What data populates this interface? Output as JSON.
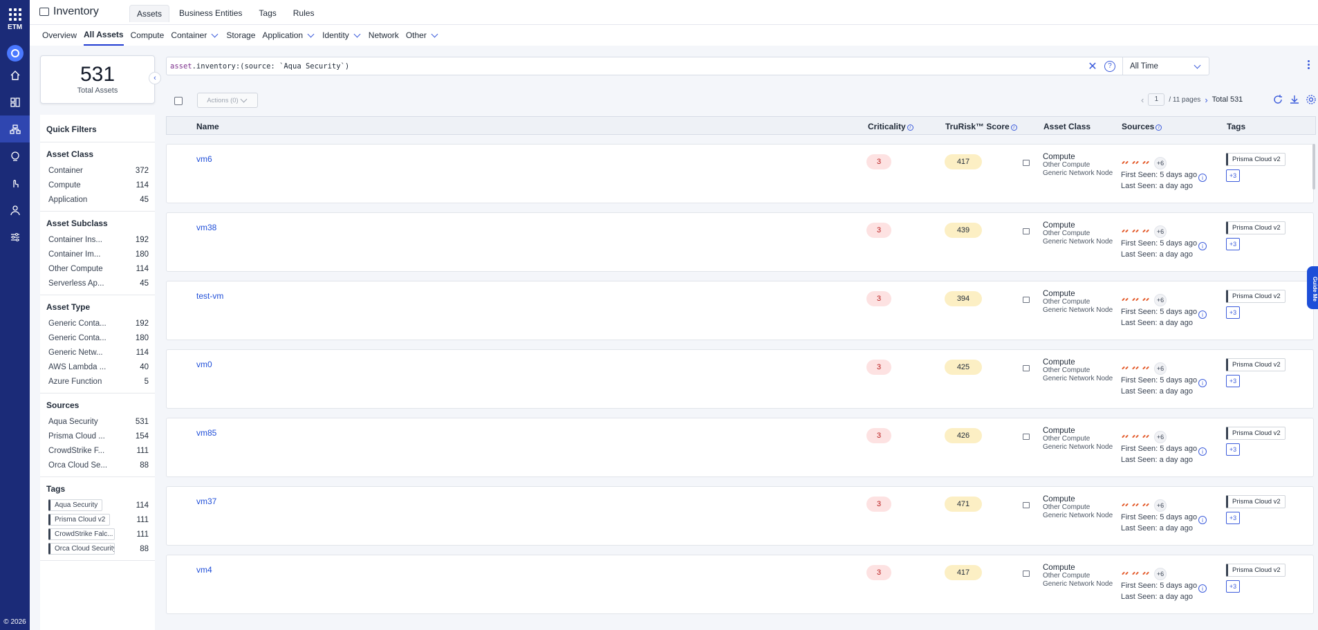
{
  "rail": {
    "product": "ETM",
    "copyright": "© 2026",
    "icons": [
      "apps-grid-icon",
      "qualys-logo-icon",
      "home-icon",
      "dashboard-icon",
      "inventory-icon",
      "risk-icon",
      "touch-icon",
      "user-icon",
      "settings-sliders-icon"
    ]
  },
  "header": {
    "title": "Inventory",
    "tabs": [
      {
        "label": "Assets",
        "active": true
      },
      {
        "label": "Business Entities",
        "active": false
      },
      {
        "label": "Tags",
        "active": false
      },
      {
        "label": "Rules",
        "active": false
      }
    ]
  },
  "subnav": [
    {
      "label": "Overview",
      "active": false,
      "dropdown": false
    },
    {
      "label": "All Assets",
      "active": true,
      "dropdown": false
    },
    {
      "label": "Compute",
      "active": false,
      "dropdown": false
    },
    {
      "label": "Container",
      "active": false,
      "dropdown": true
    },
    {
      "label": "Storage",
      "active": false,
      "dropdown": false
    },
    {
      "label": "Application",
      "active": false,
      "dropdown": true
    },
    {
      "label": "Identity",
      "active": false,
      "dropdown": true
    },
    {
      "label": "Network",
      "active": false,
      "dropdown": false
    },
    {
      "label": "Other",
      "active": false,
      "dropdown": true
    }
  ],
  "summary": {
    "total": "531",
    "label": "Total Assets"
  },
  "quick_filters": {
    "title": "Quick Filters",
    "groups": [
      {
        "title": "Asset Class",
        "items": [
          {
            "label": "Container",
            "count": "372"
          },
          {
            "label": "Compute",
            "count": "114"
          },
          {
            "label": "Application",
            "count": "45"
          }
        ]
      },
      {
        "title": "Asset Subclass",
        "items": [
          {
            "label": "Container Ins...",
            "count": "192"
          },
          {
            "label": "Container Im...",
            "count": "180"
          },
          {
            "label": "Other Compute",
            "count": "114"
          },
          {
            "label": "Serverless Ap...",
            "count": "45"
          }
        ]
      },
      {
        "title": "Asset Type",
        "items": [
          {
            "label": "Generic Conta...",
            "count": "192"
          },
          {
            "label": "Generic Conta...",
            "count": "180"
          },
          {
            "label": "Generic Netw...",
            "count": "114"
          },
          {
            "label": "AWS Lambda ...",
            "count": "40"
          },
          {
            "label": "Azure Function",
            "count": "5"
          }
        ]
      },
      {
        "title": "Sources",
        "items": [
          {
            "label": "Aqua Security",
            "count": "531"
          },
          {
            "label": "Prisma Cloud ...",
            "count": "154"
          },
          {
            "label": "CrowdStrike F...",
            "count": "111"
          },
          {
            "label": "Orca Cloud Se...",
            "count": "88"
          }
        ]
      }
    ],
    "tags": {
      "title": "Tags",
      "items": [
        {
          "label": "Aqua Security",
          "count": "114"
        },
        {
          "label": "Prisma Cloud v2",
          "count": "111"
        },
        {
          "label": "CrowdStrike Falc...",
          "count": "111"
        },
        {
          "label": "Orca Cloud Security",
          "count": "88"
        }
      ]
    }
  },
  "search": {
    "query_prefix": "asset",
    "query_rest": ".inventory:(source: `Aqua Security`)",
    "time_filter": "All Time"
  },
  "toolbar": {
    "actions_label": "Actions (0)",
    "page": "1",
    "pages_label": "/ 11 pages",
    "total_label": "Total 531"
  },
  "columns": {
    "name": "Name",
    "criticality": "Criticality",
    "score": "TruRisk™ Score",
    "asset_class": "Asset Class",
    "sources": "Sources",
    "tags": "Tags"
  },
  "rows": [
    {
      "name": "vm6",
      "criticality": "3",
      "score": "417",
      "cls": "Compute",
      "subclass": "Other Compute",
      "type": "Generic Network Node",
      "more_sources": "+6",
      "first_seen": "First Seen: 5 days ago",
      "last_seen": "Last Seen: a day ago",
      "tag": "Prisma Cloud v2",
      "more_tags": "+3"
    },
    {
      "name": "vm38",
      "criticality": "3",
      "score": "439",
      "cls": "Compute",
      "subclass": "Other Compute",
      "type": "Generic Network Node",
      "more_sources": "+6",
      "first_seen": "First Seen: 5 days ago",
      "last_seen": "Last Seen: a day ago",
      "tag": "Prisma Cloud v2",
      "more_tags": "+3"
    },
    {
      "name": "test-vm",
      "criticality": "3",
      "score": "394",
      "cls": "Compute",
      "subclass": "Other Compute",
      "type": "Generic Network Node",
      "more_sources": "+6",
      "first_seen": "First Seen: 5 days ago",
      "last_seen": "Last Seen: a day ago",
      "tag": "Prisma Cloud v2",
      "more_tags": "+3"
    },
    {
      "name": "vm0",
      "criticality": "3",
      "score": "425",
      "cls": "Compute",
      "subclass": "Other Compute",
      "type": "Generic Network Node",
      "more_sources": "+6",
      "first_seen": "First Seen: 5 days ago",
      "last_seen": "Last Seen: a day ago",
      "tag": "Prisma Cloud v2",
      "more_tags": "+3"
    },
    {
      "name": "vm85",
      "criticality": "3",
      "score": "426",
      "cls": "Compute",
      "subclass": "Other Compute",
      "type": "Generic Network Node",
      "more_sources": "+6",
      "first_seen": "First Seen: 5 days ago",
      "last_seen": "Last Seen: a day ago",
      "tag": "Prisma Cloud v2",
      "more_tags": "+3"
    },
    {
      "name": "vm37",
      "criticality": "3",
      "score": "471",
      "cls": "Compute",
      "subclass": "Other Compute",
      "type": "Generic Network Node",
      "more_sources": "+6",
      "first_seen": "First Seen: 5 days ago",
      "last_seen": "Last Seen: a day ago",
      "tag": "Prisma Cloud v2",
      "more_tags": "+3"
    },
    {
      "name": "vm4",
      "criticality": "3",
      "score": "417",
      "cls": "Compute",
      "subclass": "Other Compute",
      "type": "Generic Network Node",
      "more_sources": "+6",
      "first_seen": "First Seen: 5 days ago",
      "last_seen": "Last Seen: a day ago",
      "tag": "Prisma Cloud v2",
      "more_tags": "+3"
    }
  ],
  "guide": "Guide Me",
  "colors": {
    "rail": "#1b2b78",
    "accent": "#3b5bdb",
    "critical": "#fde2e2",
    "score": "#fcefc4"
  }
}
